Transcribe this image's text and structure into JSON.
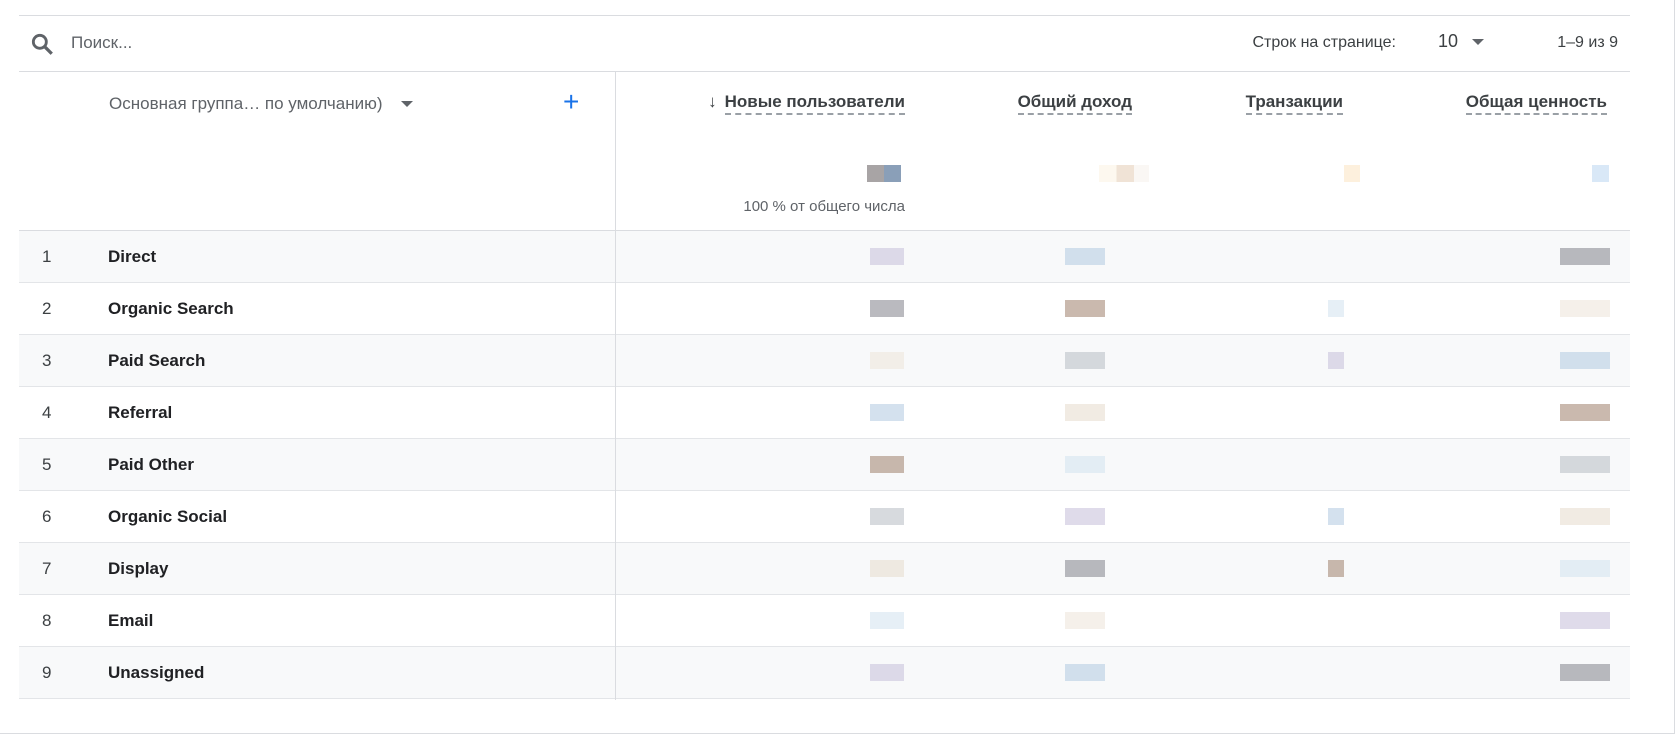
{
  "search": {
    "placeholder": "Поиск..."
  },
  "pagination": {
    "rows_label": "Строк на странице:",
    "rows_value": "10",
    "range": "1–9 из 9"
  },
  "table": {
    "dimension_header": "Основная группа… по умолчанию)",
    "add_dimension": "+",
    "sort_arrow": "↓",
    "columns": [
      "Новые пользователи",
      "Общий доход",
      "Транзакции",
      "Общая ценность"
    ],
    "total_note": "100 % от общего числа",
    "rows": [
      {
        "num": "1",
        "name": "Direct"
      },
      {
        "num": "2",
        "name": "Organic Search"
      },
      {
        "num": "3",
        "name": "Paid Search"
      },
      {
        "num": "4",
        "name": "Referral"
      },
      {
        "num": "5",
        "name": "Paid Other"
      },
      {
        "num": "6",
        "name": "Organic Social"
      },
      {
        "num": "7",
        "name": "Display"
      },
      {
        "num": "8",
        "name": "Email"
      },
      {
        "num": "9",
        "name": "Unassigned"
      }
    ]
  },
  "colors": {
    "accent": "#1a73e8",
    "divider": "#dadce0",
    "row_alt": "#f8f9fa"
  }
}
